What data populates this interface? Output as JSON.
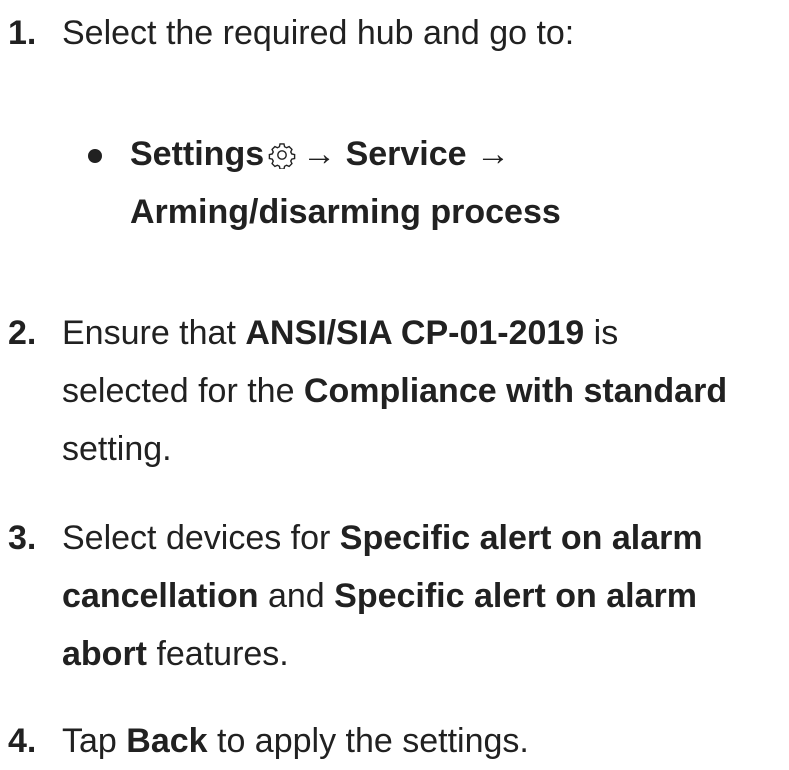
{
  "steps": [
    {
      "number": "1.",
      "text": "Select the required hub and go to:",
      "substep": {
        "settings": "Settings",
        "arrow1": "→",
        "service": "Service",
        "arrow2": "→",
        "arming": "Arming/disarming process",
        "icon": "gear-icon"
      }
    },
    {
      "number": "2.",
      "t1": "Ensure that ",
      "b1": "ANSI/SIA CP-01-2019",
      "t2": " is",
      "t3": "selected for the ",
      "b2": "Compliance with standard",
      "t4": "setting."
    },
    {
      "number": "3.",
      "t1": "Select devices for ",
      "b1": "Specific alert on alarm",
      "b2": "cancellation",
      "t2": " and ",
      "b3": "Specific alert on alarm",
      "b4": "abort",
      "t3": " features."
    },
    {
      "number": "4.",
      "t1": "Tap ",
      "b1": "Back",
      "t2": " to apply the settings."
    }
  ]
}
